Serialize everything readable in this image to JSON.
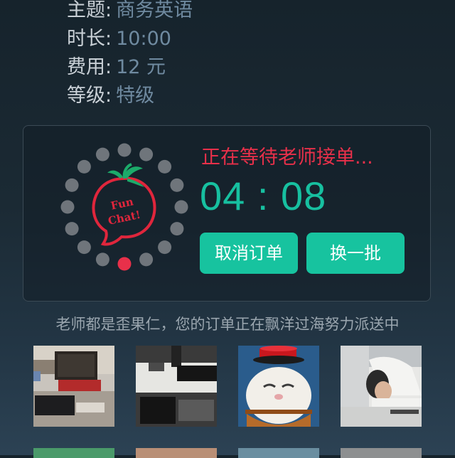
{
  "order": {
    "topic_label": "主题:",
    "topic_value": "商务英语",
    "duration_label": "时长:",
    "duration_value": "10:00",
    "fee_label": "费用:",
    "fee_value": "12 元",
    "level_label": "等级:",
    "level_value": "特级"
  },
  "waiting": {
    "status": "正在等待老师接单...",
    "timer": "04 : 08",
    "logo_text_line1": "Fun",
    "logo_text_line2": "Chat!",
    "cancel_label": "取消订单",
    "switch_label": "换一批"
  },
  "notice": "老师都是歪果仁，您的订单正在飘洋过海努力派送中",
  "teachers": [
    {
      "name": "teacher-photo-desk-monitor"
    },
    {
      "name": "teacher-photo-keyboard-desk"
    },
    {
      "name": "teacher-photo-cat-hat"
    },
    {
      "name": "teacher-photo-man-sleeping"
    }
  ],
  "colors": {
    "accent": "#17c39f",
    "status_red": "#e8304a",
    "background": "#1b2a34"
  }
}
